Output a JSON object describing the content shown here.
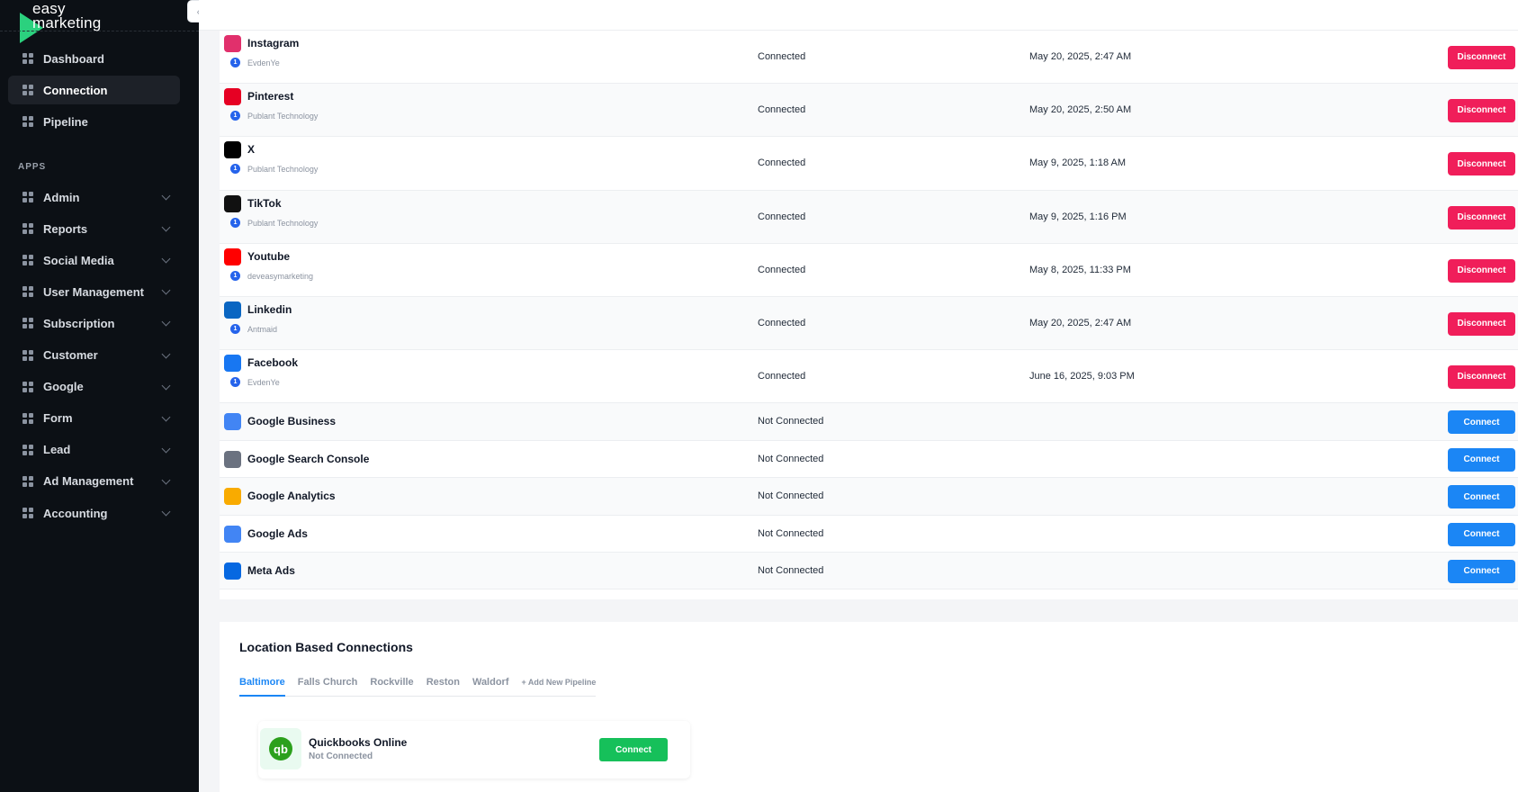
{
  "brand": {
    "line1": "easy",
    "line2": "marketing",
    "accent_color": "#2bd17e"
  },
  "sidebar": {
    "top_items": [
      {
        "label": "Dashboard",
        "icon": "dashboard-icon",
        "active": false
      },
      {
        "label": "Connection",
        "icon": "connection-icon",
        "active": true
      },
      {
        "label": "Pipeline",
        "icon": "pipeline-icon",
        "active": false
      }
    ],
    "apps_label": "APPS",
    "app_items": [
      {
        "label": "Admin",
        "icon": "admin-icon"
      },
      {
        "label": "Reports",
        "icon": "reports-icon"
      },
      {
        "label": "Social Media",
        "icon": "star-icon"
      },
      {
        "label": "User Management",
        "icon": "users-icon"
      },
      {
        "label": "Subscription",
        "icon": "subscription-icon"
      },
      {
        "label": "Customer",
        "icon": "customer-icon"
      },
      {
        "label": "Google",
        "icon": "google-icon"
      },
      {
        "label": "Form",
        "icon": "folder-icon"
      },
      {
        "label": "Lead",
        "icon": "lead-icon"
      },
      {
        "label": "Ad Management",
        "icon": "ad-icon"
      },
      {
        "label": "Accounting",
        "icon": "accounting-icon"
      }
    ]
  },
  "connections": [
    {
      "platform": "Instagram",
      "account": "EvdenYe",
      "status": "Connected",
      "date": "May 20, 2025, 2:47 AM",
      "action": "Disconnect",
      "icon": "instagram-icon",
      "color": "#e1306c"
    },
    {
      "platform": "Pinterest",
      "account": "Publant Technology",
      "status": "Connected",
      "date": "May 20, 2025, 2:50 AM",
      "action": "Disconnect",
      "icon": "pinterest-icon",
      "color": "#e60023"
    },
    {
      "platform": "X",
      "account": "Publant Technology",
      "status": "Connected",
      "date": "May 9, 2025, 1:18 AM",
      "action": "Disconnect",
      "icon": "x-icon",
      "color": "#000000"
    },
    {
      "platform": "TikTok",
      "account": "Publant Technology",
      "status": "Connected",
      "date": "May 9, 2025, 1:16 PM",
      "action": "Disconnect",
      "icon": "tiktok-icon",
      "color": "#111111"
    },
    {
      "platform": "Youtube",
      "account": "deveasymarketing",
      "status": "Connected",
      "date": "May 8, 2025, 11:33 PM",
      "action": "Disconnect",
      "icon": "youtube-icon",
      "color": "#ff0000"
    },
    {
      "platform": "Linkedin",
      "account": "Antmaid",
      "status": "Connected",
      "date": "May 20, 2025, 2:47 AM",
      "action": "Disconnect",
      "icon": "linkedin-icon",
      "color": "#0a66c2"
    },
    {
      "platform": "Facebook",
      "account": "EvdenYe",
      "status": "Connected",
      "date": "June 16, 2025, 9:03 PM",
      "action": "Disconnect",
      "icon": "facebook-icon",
      "color": "#1877f2"
    },
    {
      "platform": "Google Business",
      "status": "Not Connected",
      "action": "Connect",
      "icon": "google-business-icon",
      "color": "#4285f4"
    },
    {
      "platform": "Google Search Console",
      "status": "Not Connected",
      "action": "Connect",
      "icon": "google-search-console-icon",
      "color": "#6b7280"
    },
    {
      "platform": "Google Analytics",
      "status": "Not Connected",
      "action": "Connect",
      "icon": "google-analytics-icon",
      "color": "#f9ab00"
    },
    {
      "platform": "Google Ads",
      "status": "Not Connected",
      "action": "Connect",
      "icon": "google-ads-icon",
      "color": "#4285f4"
    },
    {
      "platform": "Meta Ads",
      "status": "Not Connected",
      "action": "Connect",
      "icon": "meta-ads-icon",
      "color": "#0668e1"
    }
  ],
  "account_badge": "1",
  "location": {
    "title": "Location Based Connections",
    "tabs": [
      "Baltimore",
      "Falls Church",
      "Rockville",
      "Reston",
      "Waldorf"
    ],
    "add_tab": "+ Add New Pipeline",
    "quickbooks": {
      "name": "Quickbooks Online",
      "status": "Not Connected",
      "button": "Connect",
      "logo_text": "qb"
    }
  },
  "collapse_glyph": "‹"
}
